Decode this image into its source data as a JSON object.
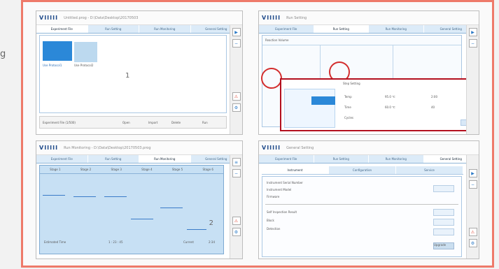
{
  "outside_text": "g",
  "panels": {
    "top_left": {
      "title": "Untitled.prog - D:\\Data\\Desktop\\20170503",
      "tabs": [
        "Experiment File",
        "Run Setting",
        "Run Monitoring",
        "General Setting"
      ],
      "file1": "Use Protocol1",
      "file2": "Use Protocol2",
      "number": "1",
      "status": "Experiment File  (1/500)",
      "buttons": [
        "Open",
        "Import",
        "Delete",
        "Run"
      ]
    },
    "top_right": {
      "title": "Run Setting",
      "tabs": [
        "Experiment File",
        "Run Setting",
        "Run Monitoring",
        "General Setting"
      ],
      "labels": [
        "Reaction Volume",
        "Temp",
        "Time",
        "Cycles"
      ],
      "popup": "Step Setting",
      "values": [
        "95.0 ℃",
        "60.0 ℃",
        "2:00",
        "40"
      ]
    },
    "bottom_left": {
      "title": "Run Monitoring - D:\\Data\\Desktop\\20170503.prog",
      "tabs": [
        "Experiment File",
        "Run Setting",
        "Run Monitoring",
        "General Setting"
      ],
      "stages": [
        "Stage 1",
        "Stage 2",
        "Stage 3",
        "Stage 4",
        "Stage 5",
        "Stage 6"
      ],
      "number": "2",
      "footer": [
        "Estimated Time",
        "1 : 23 : 45",
        "Current",
        "2:34"
      ]
    },
    "bottom_right": {
      "title": "General Setting",
      "tabs": [
        "Experiment File",
        "Run Setting",
        "Run Monitoring",
        "General Setting"
      ],
      "sub_tabs": [
        "Instrument",
        "Configuration",
        "Service"
      ],
      "rows": [
        "Instrument Serial Number",
        "Instrument Model",
        "Firmware",
        "Self Inspection Result",
        "Block",
        "Detection"
      ],
      "button": "Upgrade"
    }
  }
}
